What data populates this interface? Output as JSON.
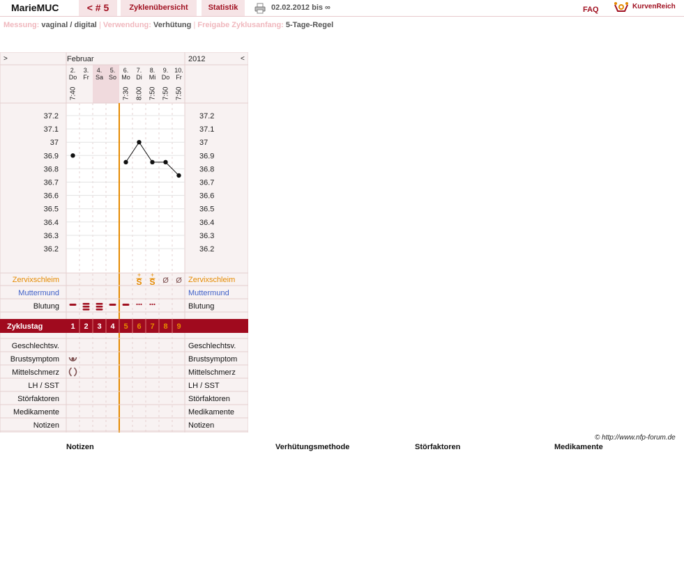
{
  "topbar": {
    "user": "MarieMUC",
    "cycle": "< # 5",
    "overview": "Zyklenübersicht",
    "stats": "Statistik",
    "print_icon": "printer-icon",
    "range": "02.02.2012 bis ∞",
    "faq": "FAQ",
    "logo_icon": "kurvenreich-logo-icon",
    "logo_text": "KurvenReich"
  },
  "info": {
    "measure_label": "Messung:",
    "measure_value": "vaginal / digital",
    "usage_label": "Verwendung:",
    "usage_value": "Verhütung",
    "release_label": "Freigabe Zyklusanfang:",
    "release_value": "5-Tage-Regel"
  },
  "chart_data": {
    "type": "line",
    "header": {
      "left_nav": ">",
      "month": "Februar",
      "year": "2012",
      "right_nav": "<"
    },
    "days": [
      {
        "date": "2.",
        "weekday": "Do",
        "time": "7:40",
        "cycle_day": "1",
        "temp": 36.9
      },
      {
        "date": "3.",
        "weekday": "Fr",
        "time": "",
        "cycle_day": "2",
        "temp": null
      },
      {
        "date": "4.",
        "weekday": "Sa",
        "time": "",
        "cycle_day": "3",
        "temp": null
      },
      {
        "date": "5.",
        "weekday": "So",
        "time": "",
        "cycle_day": "4",
        "temp": null
      },
      {
        "date": "6.",
        "weekday": "Mo",
        "time": "7:30",
        "cycle_day": "5",
        "temp": 36.85
      },
      {
        "date": "7.",
        "weekday": "Di",
        "time": "8:00",
        "cycle_day": "6",
        "temp": 37.0
      },
      {
        "date": "8.",
        "weekday": "Mi",
        "time": "7:50",
        "cycle_day": "7",
        "temp": 36.85
      },
      {
        "date": "9.",
        "weekday": "Do",
        "time": "7:50",
        "cycle_day": "8",
        "temp": 36.85
      },
      {
        "date": "10.",
        "weekday": "Fr",
        "time": "7:50",
        "cycle_day": "9",
        "temp": 36.75
      }
    ],
    "weekend_columns": [
      2,
      3
    ],
    "y_ticks": [
      "37.2",
      "37.1",
      "37",
      "36.9",
      "36.8",
      "36.7",
      "36.6",
      "36.5",
      "36.4",
      "36.3",
      "36.2"
    ],
    "ylim": [
      36.1,
      37.3
    ],
    "separator_after_day": 4,
    "line_from_day": 4,
    "rows": {
      "zervix": "Zervixschleim",
      "muttermund": "Muttermund",
      "blutung": "Blutung",
      "zyklustag": "Zyklustag",
      "geschlechtsv": "Geschlechtsv.",
      "brustsymptom": "Brustsymptom",
      "mittelschmerz": "Mittelschmerz",
      "lh": "LH / SST",
      "stoer": "Störfaktoren",
      "medi": "Medikamente",
      "notizen": "Notizen"
    },
    "cervix_marks": {
      "5": "S+",
      "6": "S+",
      "7": "Ø",
      "8": "Ø"
    },
    "bleeding": [
      "medium",
      "heavy",
      "heavy",
      "medium",
      "medium",
      "spotting",
      "spotting",
      "",
      ""
    ],
    "breast_symptom_days": [
      0
    ],
    "mittelschmerz_days": [
      0
    ]
  },
  "copyright": "© http://www.nfp-forum.de",
  "bottom": {
    "notes": "Notizen",
    "method": "Verhütungsmethode",
    "factors": "Störfaktoren",
    "meds": "Medikamente"
  },
  "colors": {
    "accent": "#a01020",
    "orange": "#e58a00",
    "blue": "#3d5fc8",
    "pink_bg": "#f6e4e6",
    "red_bar": "#a00a1e"
  }
}
